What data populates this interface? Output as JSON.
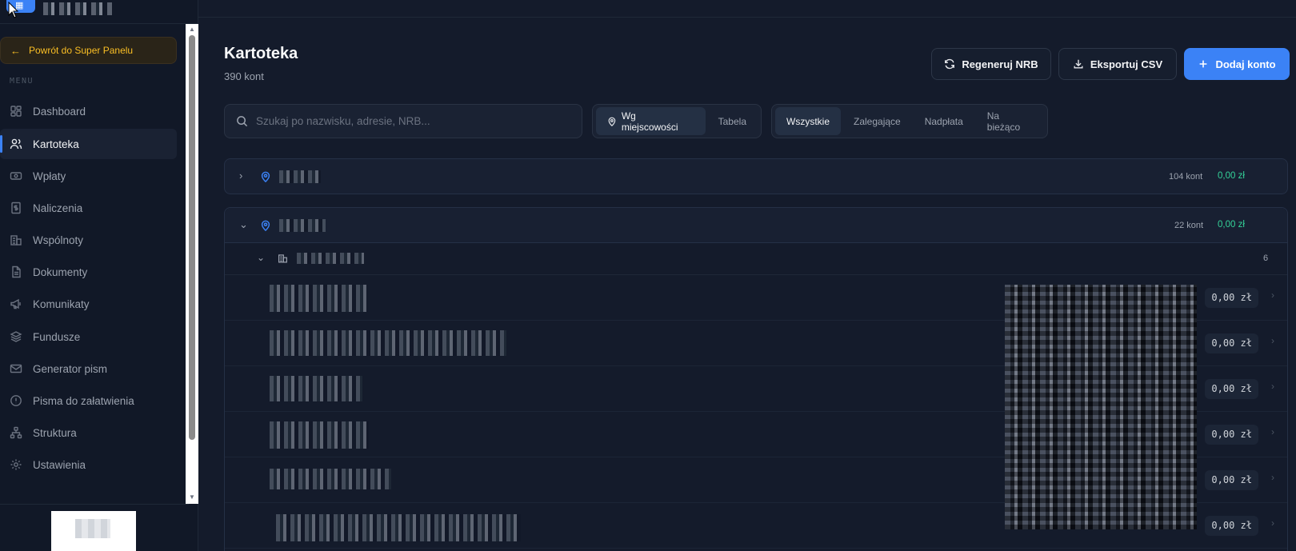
{
  "sidebar": {
    "back_label": "Powrót do Super Panelu",
    "menu_label": "MENU",
    "items": [
      {
        "label": "Dashboard",
        "icon": "dashboard-icon"
      },
      {
        "label": "Kartoteka",
        "icon": "users-icon",
        "active": true
      },
      {
        "label": "Wpłaty",
        "icon": "banknote-icon"
      },
      {
        "label": "Naliczenia",
        "icon": "receipt-icon"
      },
      {
        "label": "Wspólnoty",
        "icon": "building-icon"
      },
      {
        "label": "Dokumenty",
        "icon": "file-icon"
      },
      {
        "label": "Komunikaty",
        "icon": "megaphone-icon"
      },
      {
        "label": "Fundusze",
        "icon": "layers-icon"
      },
      {
        "label": "Generator pism",
        "icon": "mail-icon"
      },
      {
        "label": "Pisma do załatwienia",
        "icon": "alert-circle-icon"
      },
      {
        "label": "Struktura",
        "icon": "network-icon"
      },
      {
        "label": "Ustawienia",
        "icon": "gear-icon"
      }
    ]
  },
  "header": {
    "title": "Kartoteka",
    "subtitle": "390 kont",
    "regen_label": "Regeneruj NRB",
    "export_label": "Eksportuj CSV",
    "add_label": "Dodaj konto"
  },
  "search": {
    "placeholder": "Szukaj po nazwisku, adresie, NRB..."
  },
  "view_toggle": {
    "by_city": "Wg miejscowości",
    "table": "Tabela"
  },
  "filters": {
    "all": "Wszystkie",
    "overdue": "Zalegające",
    "overpaid": "Nadpłata",
    "current": "Na bieżąco"
  },
  "groups": [
    {
      "count": "104 kont",
      "amount": "0,00 zł",
      "expanded": false
    },
    {
      "count": "22 kont",
      "amount": "0,00 zł",
      "expanded": true
    }
  ],
  "subgroup": {
    "count": "6"
  },
  "rows": [
    {
      "amount": "0,00 zł"
    },
    {
      "amount": "0,00 zł"
    },
    {
      "amount": "0,00 zł"
    },
    {
      "amount": "0,00 zł"
    },
    {
      "amount": "0,00 zł"
    },
    {
      "amount": "0,00 zł"
    }
  ],
  "colors": {
    "accent": "#3b82f6",
    "warning": "#fbbf24",
    "success": "#34d399",
    "bg": "#141b2b"
  }
}
